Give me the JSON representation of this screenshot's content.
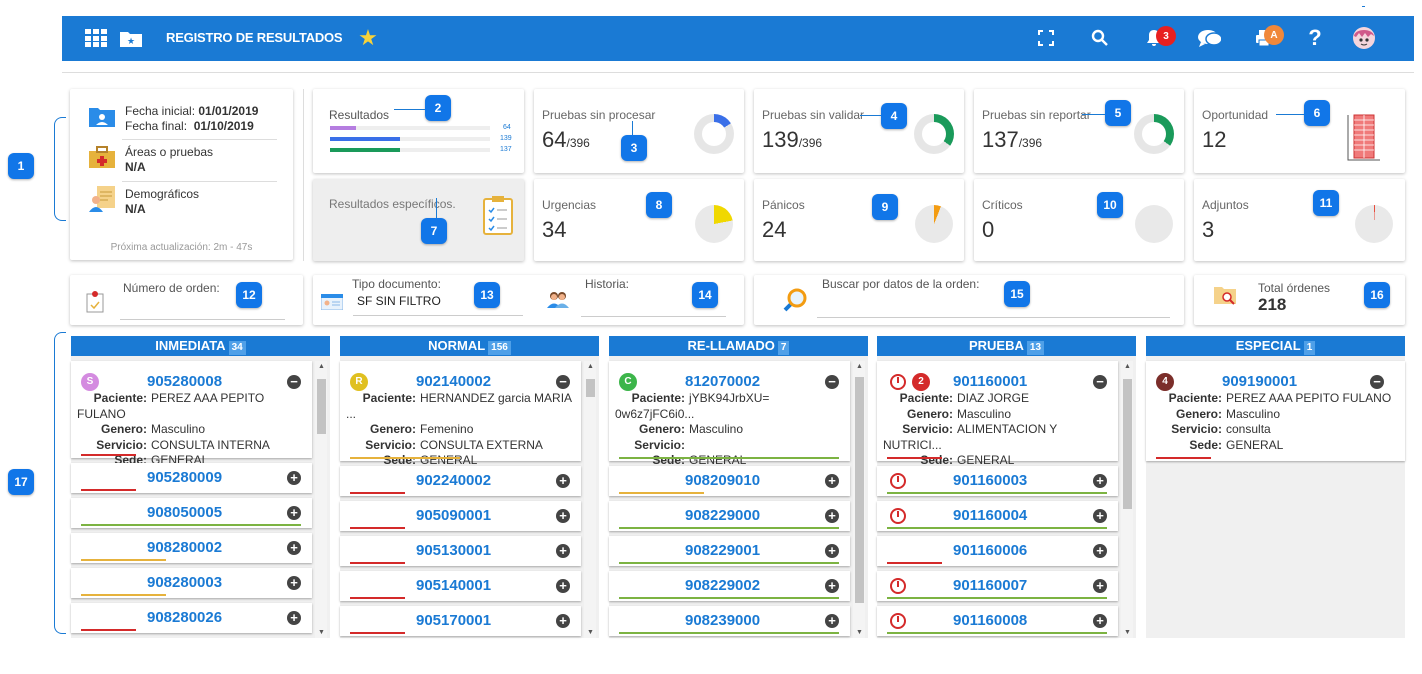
{
  "topbar": {
    "title": "REGISTRO DE RESULTADOS",
    "notif_count": "3",
    "print_badge": "A"
  },
  "summary": {
    "fecha_inicial_label": "Fecha inicial:",
    "fecha_inicial": "01/01/2019",
    "fecha_final_label": "Fecha final:",
    "fecha_final": "01/10/2019",
    "areas_label": "Áreas o pruebas",
    "areas_val": "N/A",
    "demo_label": "Demográficos",
    "demo_val": "N/A",
    "update": "Próxima actualización: 2m - 47s"
  },
  "resultados": {
    "label": "Resultados",
    "v1": "64",
    "v2": "139",
    "v3": "137",
    "specific": "Resultados específicos."
  },
  "metrics": [
    {
      "label": "Pruebas sin procesar",
      "value": "64",
      "total": "/396",
      "color": "#3a6fe8",
      "fraction": 0.16
    },
    {
      "label": "Pruebas sin validar",
      "value": "139",
      "total": "/396",
      "color": "#1a9a5a",
      "fraction": 0.35
    },
    {
      "label": "Pruebas sin reportar",
      "value": "137",
      "total": "/396",
      "color": "#1a9a5a",
      "fraction": 0.35
    },
    {
      "label": "Oportunidad",
      "value": "12"
    },
    {
      "label": "Urgencias",
      "value": "34",
      "color": "#f0d800",
      "fraction": 0.22
    },
    {
      "label": "Pánicos",
      "value": "24",
      "color": "#f39c12",
      "fraction": 0.06
    },
    {
      "label": "Críticos",
      "value": "0"
    },
    {
      "label": "Adjuntos",
      "value": "3",
      "color": "#e74c3c",
      "fraction": 0.01
    }
  ],
  "callouts": [
    "1",
    "2",
    "3",
    "4",
    "5",
    "6",
    "7",
    "8",
    "9",
    "10",
    "11",
    "12",
    "13",
    "14",
    "15",
    "16",
    "17"
  ],
  "filters": {
    "orden_label": "Número de orden:",
    "tipo_label": "Tipo documento:",
    "tipo_val": "SF SIN FILTRO",
    "historia_label": "Historia:",
    "buscar_label": "Buscar por datos de la orden:",
    "total_label": "Total órdenes",
    "total_val": "218"
  },
  "fields": {
    "paciente": "Paciente:",
    "genero": "Genero:",
    "servicio": "Servicio:",
    "sede": "Sede:"
  },
  "columns": [
    {
      "name": "INMEDIATA",
      "count": "34",
      "first": {
        "badge": "S",
        "badge_color": "#d48be0",
        "id": "905280008",
        "paciente": "PEREZ AAA PEPITO FULANO",
        "genero": "Masculino",
        "servicio": "CONSULTA INTERNA",
        "sede": "GENERAL",
        "bar": "#d42a2a"
      },
      "items": [
        {
          "id": "905280009",
          "bar": "#d42a2a"
        },
        {
          "id": "908050005",
          "bar": "#7cb342"
        },
        {
          "id": "908280002",
          "bar": "#e6b23c"
        },
        {
          "id": "908280003",
          "bar": "#e6b23c"
        },
        {
          "id": "908280026",
          "bar": "#d42a2a"
        }
      ]
    },
    {
      "name": "NORMAL",
      "count": "156",
      "first": {
        "badge": "R",
        "badge_color": "#e0c020",
        "id": "902140002",
        "paciente": "HERNANDEZ garcia MARIA ...",
        "genero": "Femenino",
        "servicio": "CONSULTA EXTERNA",
        "sede": "GENERAL",
        "bar": "#e6b23c"
      },
      "items": [
        {
          "id": "902240002",
          "bar": "#d42a2a"
        },
        {
          "id": "905090001",
          "bar": "#d42a2a"
        },
        {
          "id": "905130001",
          "bar": "#d42a2a"
        },
        {
          "id": "905140001",
          "bar": "#d42a2a"
        },
        {
          "id": "905170001",
          "bar": "#d42a2a"
        }
      ]
    },
    {
      "name": "RE-LLAMADO",
      "count": "7",
      "first": {
        "badge": "C",
        "badge_color": "#3cb54a",
        "id": "812070002",
        "paciente": "jYBK94JrbXU= 0w6z7jFC6i0...",
        "genero": "Masculino",
        "servicio": "",
        "sede": "GENERAL",
        "bar": "#7cb342"
      },
      "items": [
        {
          "id": "908209010",
          "bar": "#e6b23c"
        },
        {
          "id": "908229000",
          "bar": "#7cb342"
        },
        {
          "id": "908229001",
          "bar": "#7cb342"
        },
        {
          "id": "908229002",
          "bar": "#7cb342"
        },
        {
          "id": "908239000",
          "bar": "#7cb342"
        }
      ]
    },
    {
      "name": "PRUEBA",
      "count": "13",
      "first": {
        "badge": "2",
        "badge_color": "#d42a2a",
        "id": "901160001",
        "paciente": "DIAZ JORGE",
        "genero": "Masculino",
        "servicio": "ALIMENTACION Y NUTRICI...",
        "sede": "GENERAL",
        "bar": "#d42a2a"
      },
      "items": [
        {
          "id": "901160003",
          "bar": "#7cb342"
        },
        {
          "id": "901160004",
          "bar": "#7cb342"
        },
        {
          "id": "901160006",
          "bar": "#d42a2a"
        },
        {
          "id": "901160007",
          "bar": "#7cb342"
        },
        {
          "id": "901160008",
          "bar": "#7cb342"
        }
      ]
    },
    {
      "name": "ESPECIAL",
      "count": "1",
      "first": {
        "badge": "4",
        "badge_color": "#7b2e2a",
        "id": "909190001",
        "paciente": "PEREZ AAA PEPITO FULANO",
        "genero": "Masculino",
        "servicio": "consulta",
        "sede": "GENERAL",
        "bar": "#d42a2a"
      },
      "items": []
    }
  ]
}
